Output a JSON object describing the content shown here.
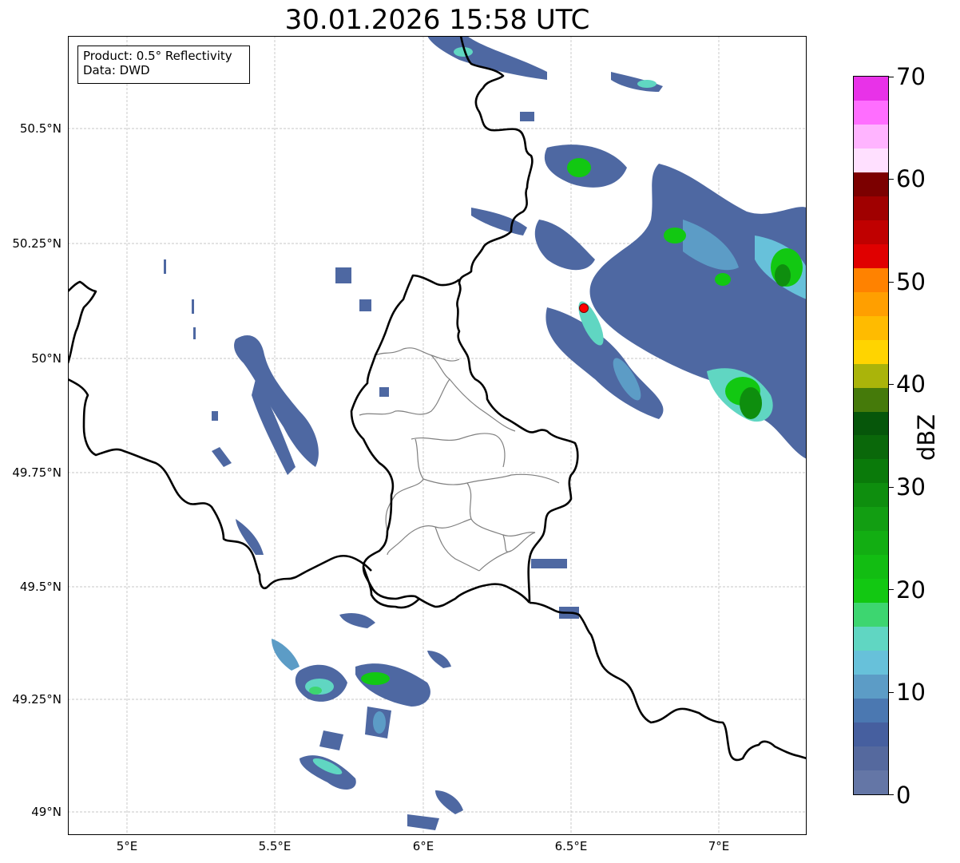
{
  "title": "30.01.2026 15:58 UTC",
  "info": {
    "product": "Product: 0.5° Reflectivity",
    "data": "Data: DWD"
  },
  "lat_labels": [
    "50.5°N",
    "50.25°N",
    "50°N",
    "49.75°N",
    "49.5°N",
    "49.25°N",
    "49°N"
  ],
  "lon_labels": [
    "5°E",
    "5.5°E",
    "6°E",
    "6.5°E",
    "7°E"
  ],
  "colorbar": {
    "label": "dBZ",
    "tick_labels": [
      "0",
      "10",
      "20",
      "30",
      "40",
      "50",
      "60",
      "70"
    ],
    "colors": [
      "#6476a6",
      "#55699e",
      "#465f9f",
      "#4b78b1",
      "#5c9cc6",
      "#67c1da",
      "#60d6c2",
      "#3dd670",
      "#12c812",
      "#12bd12",
      "#12ae12",
      "#129e12",
      "#0e8e0e",
      "#0a7a0a",
      "#0a680a",
      "#06560a",
      "#457a0a",
      "#aab40a",
      "#ffd400",
      "#ffbb00",
      "#ff9f00",
      "#ff8200",
      "#e00000",
      "#c00000",
      "#a00000",
      "#7c0000",
      "#ffe0ff",
      "#ffb4ff",
      "#ff6eff",
      "#e832e8"
    ]
  },
  "radar_site_color": "#ff0000"
}
